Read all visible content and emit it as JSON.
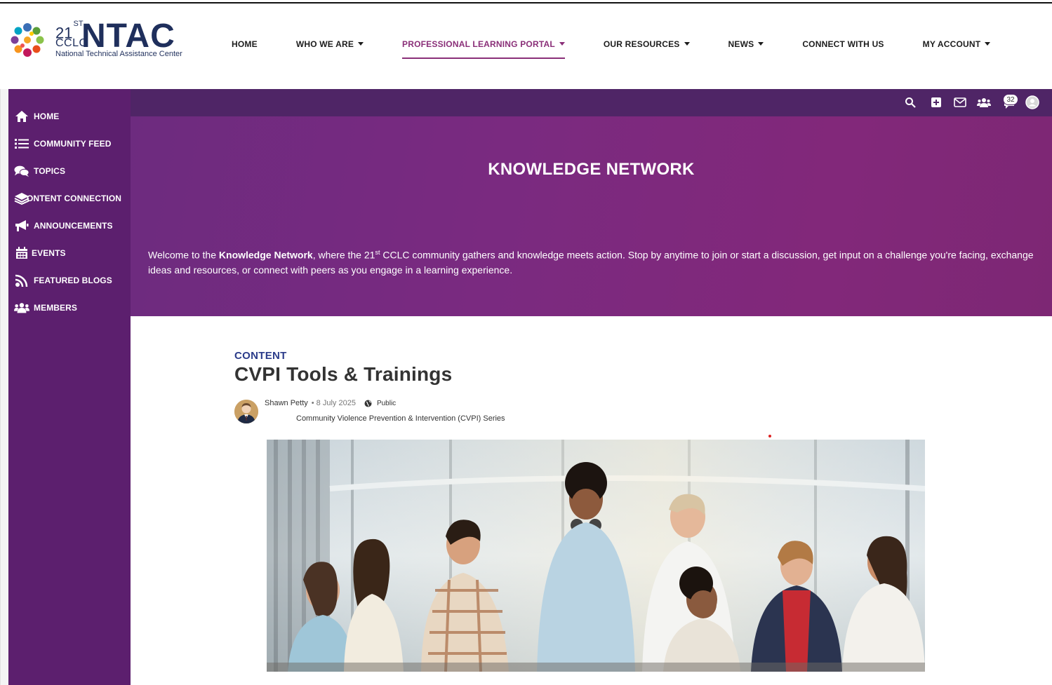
{
  "logo": {
    "num": "21",
    "sup": "ST",
    "cclc": "CCLC",
    "ntac": "NTAC",
    "subtitle": "National Technical Assistance Center"
  },
  "nav": {
    "home": "HOME",
    "who": "WHO WE ARE",
    "portal": "PROFESSIONAL LEARNING PORTAL",
    "resources": "OUR RESOURCES",
    "news": "NEWS",
    "connect": "CONNECT WITH US",
    "account": "MY ACCOUNT"
  },
  "sidebar": {
    "items": [
      {
        "label": "HOME",
        "icon": "home-icon"
      },
      {
        "label": "COMMUNITY FEED",
        "icon": "list-icon"
      },
      {
        "label": "TOPICS",
        "icon": "chat-bubbles-icon"
      },
      {
        "label": "ONTENT CONNECTION",
        "icon": "layers-icon"
      },
      {
        "label": "ANNOUNCEMENTS",
        "icon": "megaphone-icon"
      },
      {
        "label": "EVENTS",
        "icon": "calendar-icon"
      },
      {
        "label": "FEATURED BLOGS",
        "icon": "rss-icon"
      },
      {
        "label": "MEMBERS",
        "icon": "members-icon"
      }
    ]
  },
  "toolbar": {
    "notification_count": "32",
    "icons": [
      "search-icon",
      "add-icon",
      "mail-icon",
      "groups-icon",
      "notifications-icon",
      "profile-icon"
    ]
  },
  "banner": {
    "title": "KNOWLEDGE NETWORK",
    "intro_pre": "Welcome to the ",
    "intro_bold": "Knowledge Network",
    "intro_mid": ", where the 21",
    "intro_sup": "st",
    "intro_post": " CCLC community gathers and knowledge meets action. Stop by anytime to join or start a discussion, get input on a challenge you're facing, exchange ideas and resources, or connect with peers as you engage in a learning experience."
  },
  "post": {
    "category": "CONTENT",
    "title": "CVPI Tools & Trainings",
    "author": "Shawn Petty",
    "date": "• 8 July 2025",
    "visibility": "Public",
    "series": "Community Violence Prevention & Intervention (CVPI) Series"
  },
  "colors": {
    "sidebar": "#5c1f6e",
    "toolbar": "#4f2566",
    "banner": "#7a2a80",
    "accent": "#8a2f78",
    "category": "#2b3c8a"
  }
}
